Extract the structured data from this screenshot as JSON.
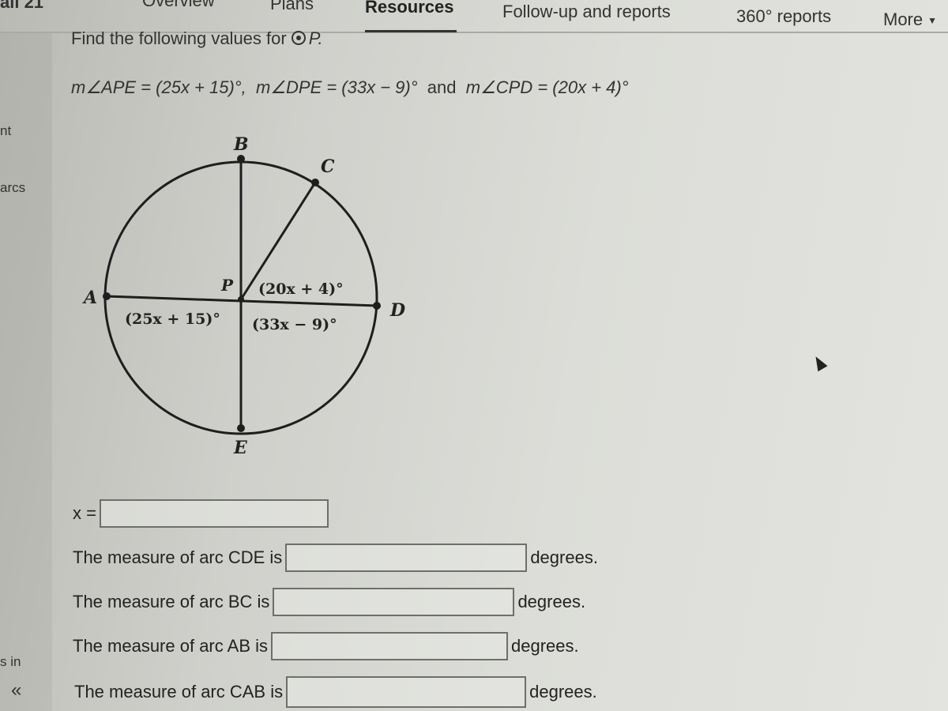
{
  "nav": {
    "course_fragment": "all 21",
    "items": [
      {
        "label": "Overview",
        "active": false
      },
      {
        "label": "Plans",
        "active": false
      },
      {
        "label": "Resources",
        "active": true
      },
      {
        "label": "Follow-up and reports",
        "active": false
      },
      {
        "label": "360° reports",
        "active": false
      },
      {
        "label": "More",
        "active": false
      }
    ]
  },
  "sidebar": {
    "fragments": [
      "nt",
      "arcs",
      "s in"
    ],
    "collapse_icon": "«"
  },
  "question": {
    "prompt": "Find the following values for",
    "circle_name": "P.",
    "equation": {
      "part1": "m∠APE = (25x + 15)°,",
      "part2": "m∠DPE = (33x − 9)°",
      "and": "and",
      "part3": "m∠CPD = (20x + 4)°"
    }
  },
  "diagram": {
    "points": {
      "A": "A",
      "B": "B",
      "C": "C",
      "D": "D",
      "E": "E",
      "P": "P"
    },
    "angle_labels": {
      "CPD": "(20x + 4)°",
      "APE": "(25x + 15)°",
      "DPE": "(33x − 9)°"
    }
  },
  "answers": {
    "x": {
      "label": "x =",
      "value": ""
    },
    "rows": [
      {
        "label": "The measure of arc CDE is",
        "value": "",
        "unit": "degrees."
      },
      {
        "label": "The measure of arc BC is",
        "value": "",
        "unit": "degrees."
      },
      {
        "label": "The measure of arc AB is",
        "value": "",
        "unit": "degrees."
      },
      {
        "label": "The measure of arc CAB is",
        "value": "",
        "unit": "degrees."
      }
    ]
  }
}
